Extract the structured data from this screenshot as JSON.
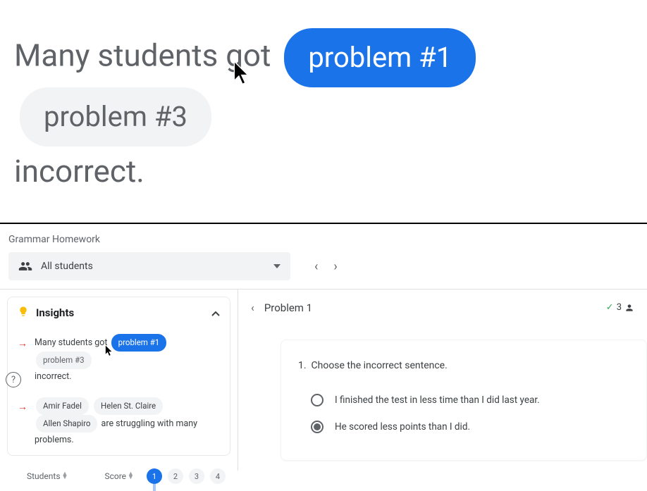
{
  "hero": {
    "prefix": "Many students got",
    "pill1": "problem #1",
    "pill2": "problem #3",
    "suffix": "incorrect."
  },
  "breadcrumb": "Grammar Homework",
  "filter": {
    "label": "All students"
  },
  "insights": {
    "title": "Insights",
    "row1": {
      "prefix": "Many students got",
      "pill1": "problem #1",
      "pill2": "problem #3",
      "suffix": "incorrect."
    },
    "row2": {
      "name1": "Amir Fadel",
      "name2": "Helen St. Claire",
      "name3": "Allen Shapiro",
      "suffix": "are struggling with many problems."
    }
  },
  "tablehead": {
    "col1": "Students",
    "col2": "Score",
    "pages": [
      "1",
      "2",
      "3",
      "4"
    ]
  },
  "help": "?",
  "problem": {
    "title": "Problem 1",
    "count": "3",
    "questionNum": "1.",
    "question": "Choose the incorrect sentence.",
    "opt1": "I finished the test in less time than I did last year.",
    "opt2": "He scored less points than I did."
  }
}
